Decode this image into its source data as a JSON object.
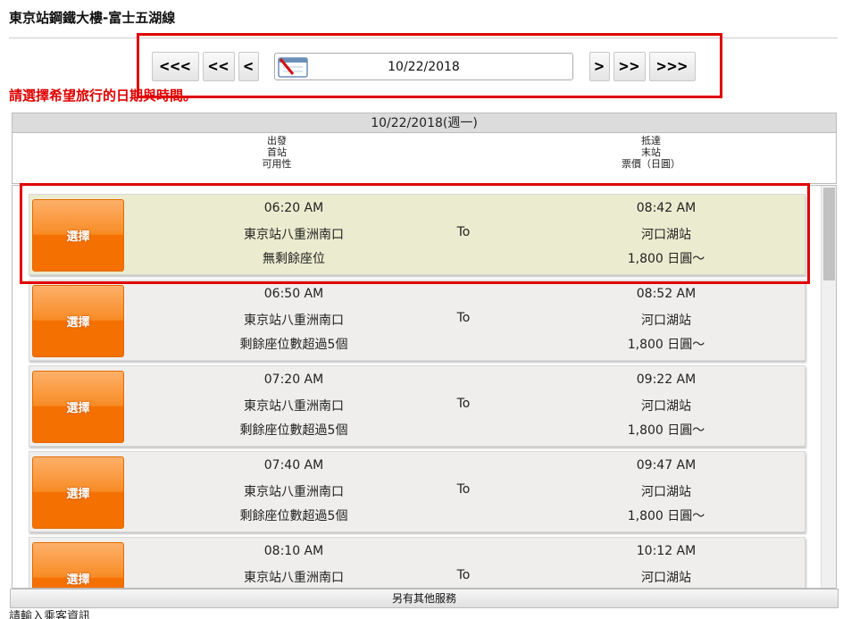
{
  "page": {
    "title": "東京站鋼鐵大樓-富士五湖線",
    "instruction": "請選擇希望旅行的日期與時間。",
    "footer_note": "請輸入乘客資訊"
  },
  "date_nav": {
    "prev3": "<<<",
    "prev2": "<<",
    "prev1": "<",
    "date_value": "10/22/2018",
    "next1": ">",
    "next2": ">>",
    "next3": ">>>"
  },
  "schedule": {
    "date_heading": "10/22/2018(週一)",
    "depart_header": [
      "出發",
      "首站",
      "可用性"
    ],
    "arrive_header": [
      "抵達",
      "末站",
      "票價（日圓）"
    ]
  },
  "trips": [
    {
      "select_label": "選擇",
      "depart_time": "06:20 AM",
      "origin": "東京站八重洲南口",
      "availability": "無剩餘座位",
      "to": "To",
      "arrive_time": "08:42 AM",
      "destination": "河口湖站",
      "fare": "1,800 日圓～"
    },
    {
      "select_label": "選擇",
      "depart_time": "06:50 AM",
      "origin": "東京站八重洲南口",
      "availability": "剩餘座位數超過5個",
      "to": "To",
      "arrive_time": "08:52 AM",
      "destination": "河口湖站",
      "fare": "1,800 日圓～"
    },
    {
      "select_label": "選擇",
      "depart_time": "07:20 AM",
      "origin": "東京站八重洲南口",
      "availability": "剩餘座位數超過5個",
      "to": "To",
      "arrive_time": "09:22 AM",
      "destination": "河口湖站",
      "fare": "1,800 日圓～"
    },
    {
      "select_label": "選擇",
      "depart_time": "07:40 AM",
      "origin": "東京站八重洲南口",
      "availability": "剩餘座位數超過5個",
      "to": "To",
      "arrive_time": "09:47 AM",
      "destination": "河口湖站",
      "fare": "1,800 日圓～"
    },
    {
      "select_label": "選擇",
      "depart_time": "08:10 AM",
      "origin": "東京站八重洲南口",
      "availability": "",
      "to": "To",
      "arrive_time": "10:12 AM",
      "destination": "河口湖站",
      "fare": ""
    }
  ],
  "other_services_label": "另有其他服務",
  "icons": {
    "calendar": "calendar-icon"
  },
  "colors": {
    "highlight": "#e00000",
    "select_button": "#f47000",
    "selected_row": "#ebebcf"
  }
}
